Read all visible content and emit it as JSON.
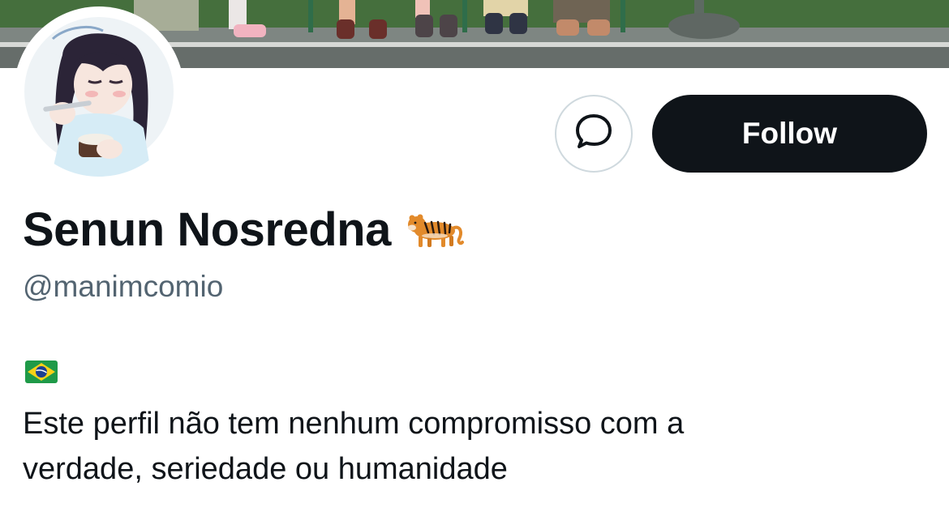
{
  "profile": {
    "display_name": "Senun Nosredna",
    "name_emoji": "tiger-emoji",
    "handle": "@manimcomio",
    "bio_flag": "brazil-flag-emoji",
    "bio_lines": [
      "Este perfil não tem nenhum compromisso com a",
      "verdade, seriedade ou humanidade"
    ]
  },
  "actions": {
    "message_icon": "chat-bubble-icon",
    "follow_label": "Follow"
  },
  "colors": {
    "text_primary": "#0f1419",
    "text_secondary": "#536471",
    "button_dark": "#0f1419",
    "button_border": "#cfd9de"
  }
}
